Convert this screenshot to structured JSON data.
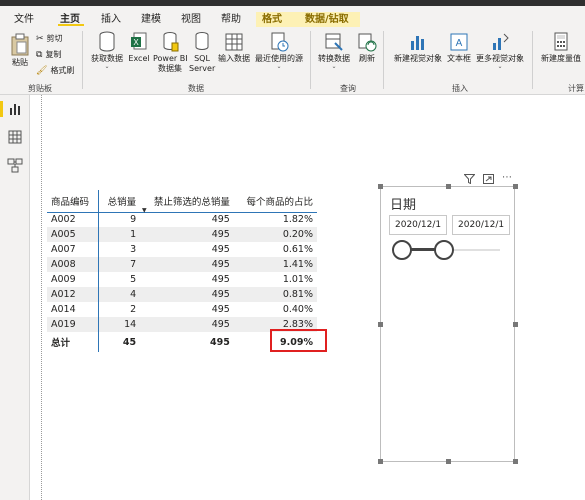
{
  "menu": {
    "file": "文件",
    "home": "主页",
    "insert": "插入",
    "modeling": "建模",
    "view": "视图",
    "help": "帮助",
    "format": "格式",
    "data_drill": "数据/钻取"
  },
  "ribbon": {
    "paste": "粘贴",
    "cut": "剪切",
    "copy": "复制",
    "format_painter": "格式刷",
    "clipboard_group": "剪贴板",
    "get_data": "获取数据",
    "excel": "Excel",
    "powerbi_l1": "Power BI",
    "powerbi_l2": "数据集",
    "sql_l1": "SQL",
    "sql_l2": "Server",
    "enter_data": "输入数据",
    "recent_sources": "最近使用的源",
    "data_group": "数据",
    "transform": "转换数据",
    "refresh": "刷新",
    "query_group": "查询",
    "new_visual": "新建视觉对象",
    "text_box": "文本框",
    "more_visuals": "更多视觉对象",
    "insert_group": "插入",
    "new_measure": "新建度量值",
    "calc_group": "计算"
  },
  "colors": {
    "accent": "#f2c811",
    "table_border": "#2e75b6",
    "highlight": "#e02020"
  },
  "table": {
    "headers": [
      "商品编码",
      "总销量",
      "禁止筛选的总销量",
      "每个商品的占比"
    ],
    "rows": [
      [
        "A002",
        "9",
        "495",
        "1.82%"
      ],
      [
        "A005",
        "1",
        "495",
        "0.20%"
      ],
      [
        "A007",
        "3",
        "495",
        "0.61%"
      ],
      [
        "A008",
        "7",
        "495",
        "1.41%"
      ],
      [
        "A009",
        "5",
        "495",
        "1.01%"
      ],
      [
        "A012",
        "4",
        "495",
        "0.81%"
      ],
      [
        "A014",
        "2",
        "495",
        "0.40%"
      ],
      [
        "A019",
        "14",
        "495",
        "2.83%"
      ]
    ],
    "total": [
      "总计",
      "45",
      "495",
      "9.09%"
    ]
  },
  "slicer": {
    "title": "日期",
    "start_date": "2020/12/1",
    "end_date": "2020/12/1"
  }
}
